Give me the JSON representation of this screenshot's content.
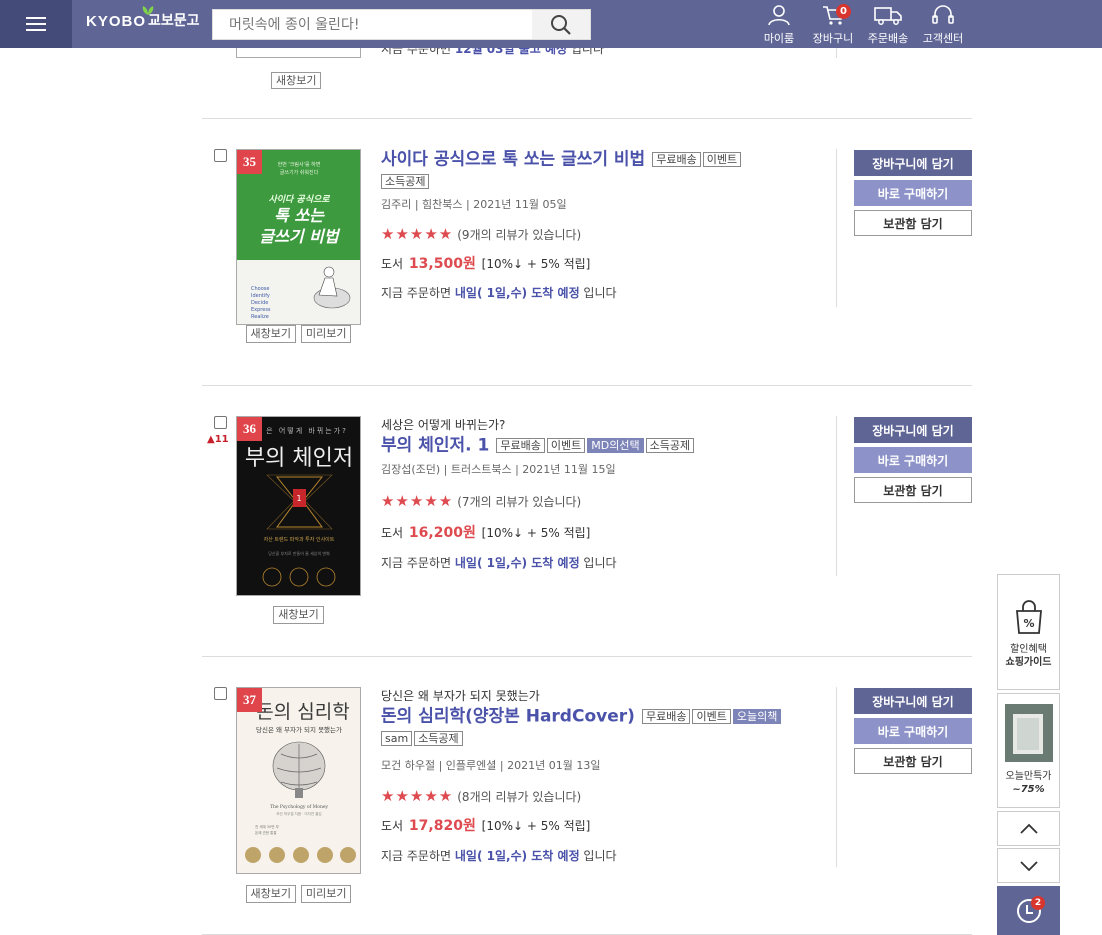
{
  "header": {
    "logo_en": "KYOBO",
    "logo_kr": "교보문고",
    "search_placeholder": "머릿속에 종이 울린다!",
    "nav": [
      {
        "label": "마이룸",
        "icon": "user-icon"
      },
      {
        "label": "장바구니",
        "icon": "cart-icon",
        "badge": "0"
      },
      {
        "label": "주문배송",
        "icon": "truck-icon"
      },
      {
        "label": "고객센터",
        "icon": "headset-icon"
      }
    ]
  },
  "prev_item": {
    "delivery_text": "지금 주문하면 ",
    "delivery_hi": "12월 03일 출고 예정",
    "delivery_tail": " 입니다",
    "new_window": "새창보기"
  },
  "items": [
    {
      "rank": "35",
      "rank_change": "",
      "subtitle": "",
      "title": "사이다 공식으로 톡 쏘는 글쓰기 비법",
      "tags": [
        {
          "t": "무료배송",
          "hl": false
        },
        {
          "t": "이벤트",
          "hl": false
        },
        {
          "t": "소득공제",
          "hl": false
        }
      ],
      "meta": "김주리  | 힘찬북스 | 2021년 11월 05일",
      "stars": "★★★★★",
      "reviews": "(9개의 리뷰가 있습니다)",
      "format": "도서",
      "price": "13,500원",
      "discount": "[10%↓ + 5% 적립]",
      "delivery_pre": "지금 주문하면 ",
      "delivery_hi": "내일( 1일,수) 도착 예정",
      "delivery_post": " 입니다",
      "buttons": [
        "새창보기",
        "미리보기"
      ],
      "cover": {
        "bg": "#3e9a3f",
        "kicker": "한 번 읽으면 끝까지 읽히는 글",
        "lines": [
          "사이다 공식으로",
          "톡 쏘는",
          "글쓰기 비법"
        ],
        "list": [
          "Choose",
          "Identify",
          "Decide",
          "Express",
          "Realize"
        ]
      }
    },
    {
      "rank": "36",
      "rank_change": "▲11",
      "subtitle": "세상은 어떻게 바뀌는가?",
      "title": "부의 체인저. 1",
      "tags": [
        {
          "t": "무료배송",
          "hl": false
        },
        {
          "t": "이벤트",
          "hl": false
        },
        {
          "t": "MD의선택",
          "hl": true
        },
        {
          "t": "소득공제",
          "hl": false
        }
      ],
      "meta": "김장섭(조던) | 트러스트북스 | 2021년 11월 15일",
      "stars": "★★★★★",
      "reviews": "(7개의 리뷰가 있습니다)",
      "format": "도서",
      "price": "16,200원",
      "discount": "[10%↓ + 5% 적립]",
      "delivery_pre": "지금 주문하면 ",
      "delivery_hi": "내일( 1일,수) 도착 예정",
      "delivery_post": " 입니다",
      "buttons": [
        "새창보기"
      ],
      "cover": {
        "bg": "#111111",
        "kicker": "세상은 어떻게 바뀌는가?",
        "lines": [
          "부의 체인저"
        ],
        "list": []
      }
    },
    {
      "rank": "37",
      "rank_change": "",
      "subtitle": "당신은 왜 부자가 되지 못했는가",
      "title": "돈의 심리학(양장본 HardCover)",
      "tags": [
        {
          "t": "무료배송",
          "hl": false
        },
        {
          "t": "이벤트",
          "hl": false
        },
        {
          "t": "오늘의책",
          "hl": true
        },
        {
          "t": "sam",
          "hl": false
        },
        {
          "t": "소득공제",
          "hl": false
        }
      ],
      "meta": "모건 하우절  | 인플루엔셜 | 2021년 01월 13일",
      "stars": "★★★★★",
      "reviews": "(8개의 리뷰가 있습니다)",
      "format": "도서",
      "price": "17,820원",
      "discount": "[10%↓ + 5% 적립]",
      "delivery_pre": "지금 주문하면 ",
      "delivery_hi": "내일( 1일,수) 도착 예정",
      "delivery_post": " 입니다",
      "buttons": [
        "새창보기",
        "미리보기"
      ],
      "cover": {
        "bg": "#f7f3ec",
        "kicker": "",
        "lines": [
          "돈의 심리학",
          "당신은 왜 부자가 되지 못했는가"
        ],
        "list": [
          "The Psychology of Money"
        ]
      }
    }
  ],
  "actions": {
    "cart": "장바구니에 담기",
    "buy": "바로 구매하기",
    "keep": "보관함 담기"
  },
  "side": {
    "guide_line1": "할인혜택",
    "guide_line2": "쇼핑가이드",
    "today_line1": "오늘만특가",
    "today_line2": "~75%",
    "recent_badge": "2"
  },
  "colors": {
    "header": "#5f6696",
    "accent": "#4a52a9",
    "price": "#dd4a4f"
  }
}
